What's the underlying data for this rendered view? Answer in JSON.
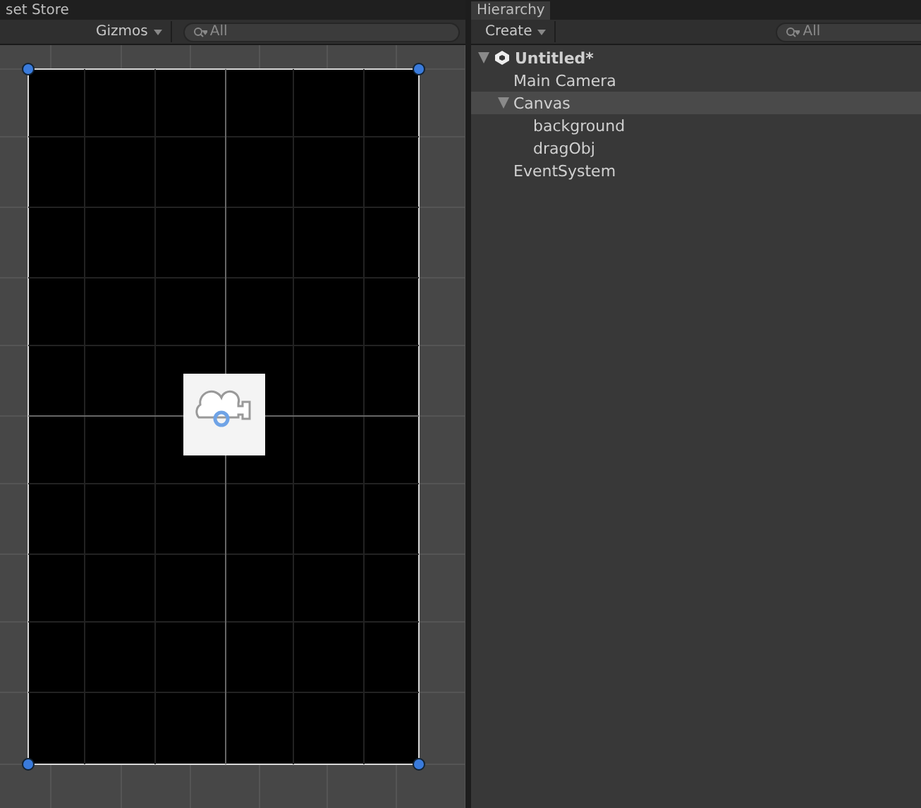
{
  "scene_panel": {
    "tab_label": "set Store",
    "toolbar": {
      "gizmos_label": "Gizmos",
      "search": {
        "placeholder": "All"
      }
    }
  },
  "hierarchy_panel": {
    "tab_label": "Hierarchy",
    "toolbar": {
      "create_label": "Create",
      "search": {
        "placeholder": "All"
      }
    },
    "tree": [
      {
        "label": "Untitled*",
        "kind": "scene",
        "expanded": true,
        "selected": false,
        "children": [
          {
            "label": "Main Camera",
            "kind": "object",
            "selected": false
          },
          {
            "label": "Canvas",
            "kind": "object",
            "expanded": true,
            "selected": true,
            "children": [
              {
                "label": "background",
                "kind": "object",
                "selected": false
              },
              {
                "label": "dragObj",
                "kind": "object",
                "selected": false
              }
            ]
          },
          {
            "label": "EventSystem",
            "kind": "object",
            "selected": false
          }
        ]
      }
    ]
  }
}
